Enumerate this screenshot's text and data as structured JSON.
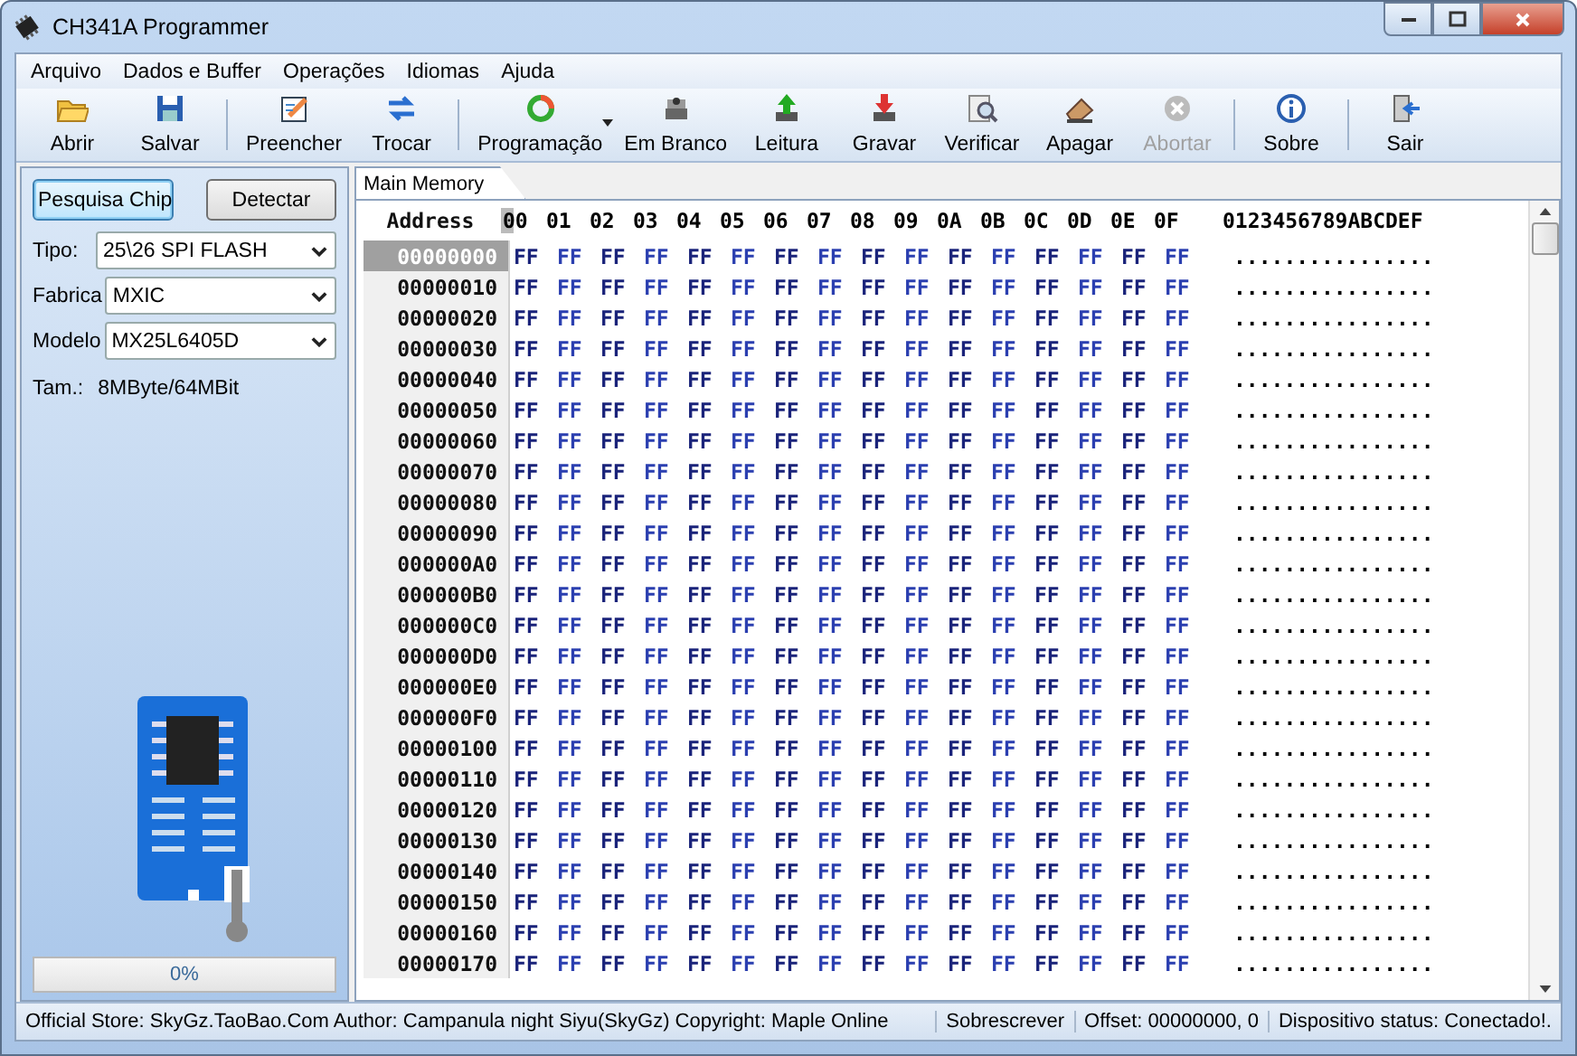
{
  "window": {
    "title": "CH341A Programmer"
  },
  "menu": [
    "Arquivo",
    "Dados e Buffer",
    "Operações",
    "Idiomas",
    "Ajuda"
  ],
  "toolbar": [
    [
      {
        "label": "Abrir",
        "disabled": false,
        "dropdown": false
      },
      {
        "label": "Salvar",
        "disabled": false,
        "dropdown": false
      }
    ],
    [
      {
        "label": "Preencher",
        "disabled": false,
        "dropdown": false
      },
      {
        "label": "Trocar",
        "disabled": false,
        "dropdown": false
      }
    ],
    [
      {
        "label": "Programação",
        "disabled": false,
        "dropdown": true
      },
      {
        "label": "Em Branco",
        "disabled": false,
        "dropdown": false
      },
      {
        "label": "Leitura",
        "disabled": false,
        "dropdown": false
      },
      {
        "label": "Gravar",
        "disabled": false,
        "dropdown": false
      },
      {
        "label": "Verificar",
        "disabled": false,
        "dropdown": false
      },
      {
        "label": "Apagar",
        "disabled": false,
        "dropdown": false
      },
      {
        "label": "Abortar",
        "disabled": true,
        "dropdown": false
      }
    ],
    [
      {
        "label": "Sobre",
        "disabled": false,
        "dropdown": false
      }
    ],
    [
      {
        "label": "Sair",
        "disabled": false,
        "dropdown": false
      }
    ]
  ],
  "left_panel": {
    "buttons": [
      {
        "label": "Pesquisa Chip",
        "focused": true
      },
      {
        "label": "Detectar",
        "focused": false
      }
    ],
    "fields": [
      {
        "label": "Tipo:",
        "value": "25\\26 SPI FLASH"
      },
      {
        "label": "Fabrica",
        "value": "MXIC"
      },
      {
        "label": "Modelo",
        "value": "MX25L6405D"
      }
    ],
    "size": {
      "label": "Tam.:",
      "value": "8MByte/64MBit"
    },
    "progress": {
      "level": 0,
      "text": "0%"
    }
  },
  "tabs": [
    {
      "label": "Main Memory",
      "selected": true
    }
  ],
  "hex": {
    "address_header": "Address",
    "columns": [
      "00",
      "01",
      "02",
      "03",
      "04",
      "05",
      "06",
      "07",
      "08",
      "09",
      "0A",
      "0B",
      "0C",
      "0D",
      "0E",
      "0F"
    ],
    "ascii_header": "0123456789ABCDEF",
    "rows": [
      {
        "address": "00000000",
        "selected": true,
        "bytes": [
          "FF",
          "FF",
          "FF",
          "FF",
          "FF",
          "FF",
          "FF",
          "FF",
          "FF",
          "FF",
          "FF",
          "FF",
          "FF",
          "FF",
          "FF",
          "FF"
        ],
        "ascii": "................"
      },
      {
        "address": "00000010",
        "selected": false,
        "bytes": [
          "FF",
          "FF",
          "FF",
          "FF",
          "FF",
          "FF",
          "FF",
          "FF",
          "FF",
          "FF",
          "FF",
          "FF",
          "FF",
          "FF",
          "FF",
          "FF"
        ],
        "ascii": "................"
      },
      {
        "address": "00000020",
        "selected": false,
        "bytes": [
          "FF",
          "FF",
          "FF",
          "FF",
          "FF",
          "FF",
          "FF",
          "FF",
          "FF",
          "FF",
          "FF",
          "FF",
          "FF",
          "FF",
          "FF",
          "FF"
        ],
        "ascii": "................"
      },
      {
        "address": "00000030",
        "selected": false,
        "bytes": [
          "FF",
          "FF",
          "FF",
          "FF",
          "FF",
          "FF",
          "FF",
          "FF",
          "FF",
          "FF",
          "FF",
          "FF",
          "FF",
          "FF",
          "FF",
          "FF"
        ],
        "ascii": "................"
      },
      {
        "address": "00000040",
        "selected": false,
        "bytes": [
          "FF",
          "FF",
          "FF",
          "FF",
          "FF",
          "FF",
          "FF",
          "FF",
          "FF",
          "FF",
          "FF",
          "FF",
          "FF",
          "FF",
          "FF",
          "FF"
        ],
        "ascii": "................"
      },
      {
        "address": "00000050",
        "selected": false,
        "bytes": [
          "FF",
          "FF",
          "FF",
          "FF",
          "FF",
          "FF",
          "FF",
          "FF",
          "FF",
          "FF",
          "FF",
          "FF",
          "FF",
          "FF",
          "FF",
          "FF"
        ],
        "ascii": "................"
      },
      {
        "address": "00000060",
        "selected": false,
        "bytes": [
          "FF",
          "FF",
          "FF",
          "FF",
          "FF",
          "FF",
          "FF",
          "FF",
          "FF",
          "FF",
          "FF",
          "FF",
          "FF",
          "FF",
          "FF",
          "FF"
        ],
        "ascii": "................"
      },
      {
        "address": "00000070",
        "selected": false,
        "bytes": [
          "FF",
          "FF",
          "FF",
          "FF",
          "FF",
          "FF",
          "FF",
          "FF",
          "FF",
          "FF",
          "FF",
          "FF",
          "FF",
          "FF",
          "FF",
          "FF"
        ],
        "ascii": "................"
      },
      {
        "address": "00000080",
        "selected": false,
        "bytes": [
          "FF",
          "FF",
          "FF",
          "FF",
          "FF",
          "FF",
          "FF",
          "FF",
          "FF",
          "FF",
          "FF",
          "FF",
          "FF",
          "FF",
          "FF",
          "FF"
        ],
        "ascii": "................"
      },
      {
        "address": "00000090",
        "selected": false,
        "bytes": [
          "FF",
          "FF",
          "FF",
          "FF",
          "FF",
          "FF",
          "FF",
          "FF",
          "FF",
          "FF",
          "FF",
          "FF",
          "FF",
          "FF",
          "FF",
          "FF"
        ],
        "ascii": "................"
      },
      {
        "address": "000000A0",
        "selected": false,
        "bytes": [
          "FF",
          "FF",
          "FF",
          "FF",
          "FF",
          "FF",
          "FF",
          "FF",
          "FF",
          "FF",
          "FF",
          "FF",
          "FF",
          "FF",
          "FF",
          "FF"
        ],
        "ascii": "................"
      },
      {
        "address": "000000B0",
        "selected": false,
        "bytes": [
          "FF",
          "FF",
          "FF",
          "FF",
          "FF",
          "FF",
          "FF",
          "FF",
          "FF",
          "FF",
          "FF",
          "FF",
          "FF",
          "FF",
          "FF",
          "FF"
        ],
        "ascii": "................"
      },
      {
        "address": "000000C0",
        "selected": false,
        "bytes": [
          "FF",
          "FF",
          "FF",
          "FF",
          "FF",
          "FF",
          "FF",
          "FF",
          "FF",
          "FF",
          "FF",
          "FF",
          "FF",
          "FF",
          "FF",
          "FF"
        ],
        "ascii": "................"
      },
      {
        "address": "000000D0",
        "selected": false,
        "bytes": [
          "FF",
          "FF",
          "FF",
          "FF",
          "FF",
          "FF",
          "FF",
          "FF",
          "FF",
          "FF",
          "FF",
          "FF",
          "FF",
          "FF",
          "FF",
          "FF"
        ],
        "ascii": "................"
      },
      {
        "address": "000000E0",
        "selected": false,
        "bytes": [
          "FF",
          "FF",
          "FF",
          "FF",
          "FF",
          "FF",
          "FF",
          "FF",
          "FF",
          "FF",
          "FF",
          "FF",
          "FF",
          "FF",
          "FF",
          "FF"
        ],
        "ascii": "................"
      },
      {
        "address": "000000F0",
        "selected": false,
        "bytes": [
          "FF",
          "FF",
          "FF",
          "FF",
          "FF",
          "FF",
          "FF",
          "FF",
          "FF",
          "FF",
          "FF",
          "FF",
          "FF",
          "FF",
          "FF",
          "FF"
        ],
        "ascii": "................"
      },
      {
        "address": "00000100",
        "selected": false,
        "bytes": [
          "FF",
          "FF",
          "FF",
          "FF",
          "FF",
          "FF",
          "FF",
          "FF",
          "FF",
          "FF",
          "FF",
          "FF",
          "FF",
          "FF",
          "FF",
          "FF"
        ],
        "ascii": "................"
      },
      {
        "address": "00000110",
        "selected": false,
        "bytes": [
          "FF",
          "FF",
          "FF",
          "FF",
          "FF",
          "FF",
          "FF",
          "FF",
          "FF",
          "FF",
          "FF",
          "FF",
          "FF",
          "FF",
          "FF",
          "FF"
        ],
        "ascii": "................"
      },
      {
        "address": "00000120",
        "selected": false,
        "bytes": [
          "FF",
          "FF",
          "FF",
          "FF",
          "FF",
          "FF",
          "FF",
          "FF",
          "FF",
          "FF",
          "FF",
          "FF",
          "FF",
          "FF",
          "FF",
          "FF"
        ],
        "ascii": "................"
      },
      {
        "address": "00000130",
        "selected": false,
        "bytes": [
          "FF",
          "FF",
          "FF",
          "FF",
          "FF",
          "FF",
          "FF",
          "FF",
          "FF",
          "FF",
          "FF",
          "FF",
          "FF",
          "FF",
          "FF",
          "FF"
        ],
        "ascii": "................"
      },
      {
        "address": "00000140",
        "selected": false,
        "bytes": [
          "FF",
          "FF",
          "FF",
          "FF",
          "FF",
          "FF",
          "FF",
          "FF",
          "FF",
          "FF",
          "FF",
          "FF",
          "FF",
          "FF",
          "FF",
          "FF"
        ],
        "ascii": "................"
      },
      {
        "address": "00000150",
        "selected": false,
        "bytes": [
          "FF",
          "FF",
          "FF",
          "FF",
          "FF",
          "FF",
          "FF",
          "FF",
          "FF",
          "FF",
          "FF",
          "FF",
          "FF",
          "FF",
          "FF",
          "FF"
        ],
        "ascii": "................"
      },
      {
        "address": "00000160",
        "selected": false,
        "bytes": [
          "FF",
          "FF",
          "FF",
          "FF",
          "FF",
          "FF",
          "FF",
          "FF",
          "FF",
          "FF",
          "FF",
          "FF",
          "FF",
          "FF",
          "FF",
          "FF"
        ],
        "ascii": "................"
      },
      {
        "address": "00000170",
        "selected": false,
        "bytes": [
          "FF",
          "FF",
          "FF",
          "FF",
          "FF",
          "FF",
          "FF",
          "FF",
          "FF",
          "FF",
          "FF",
          "FF",
          "FF",
          "FF",
          "FF",
          "FF"
        ],
        "ascii": "................"
      }
    ]
  },
  "status_bar": [
    "Official Store: SkyGz.TaoBao.Com Author: Campanula night Siyu(SkyGz) Copyright: Maple Online",
    "Sobrescrever",
    "Offset: 00000000, 0",
    "Dispositivo status: Conectado!."
  ]
}
